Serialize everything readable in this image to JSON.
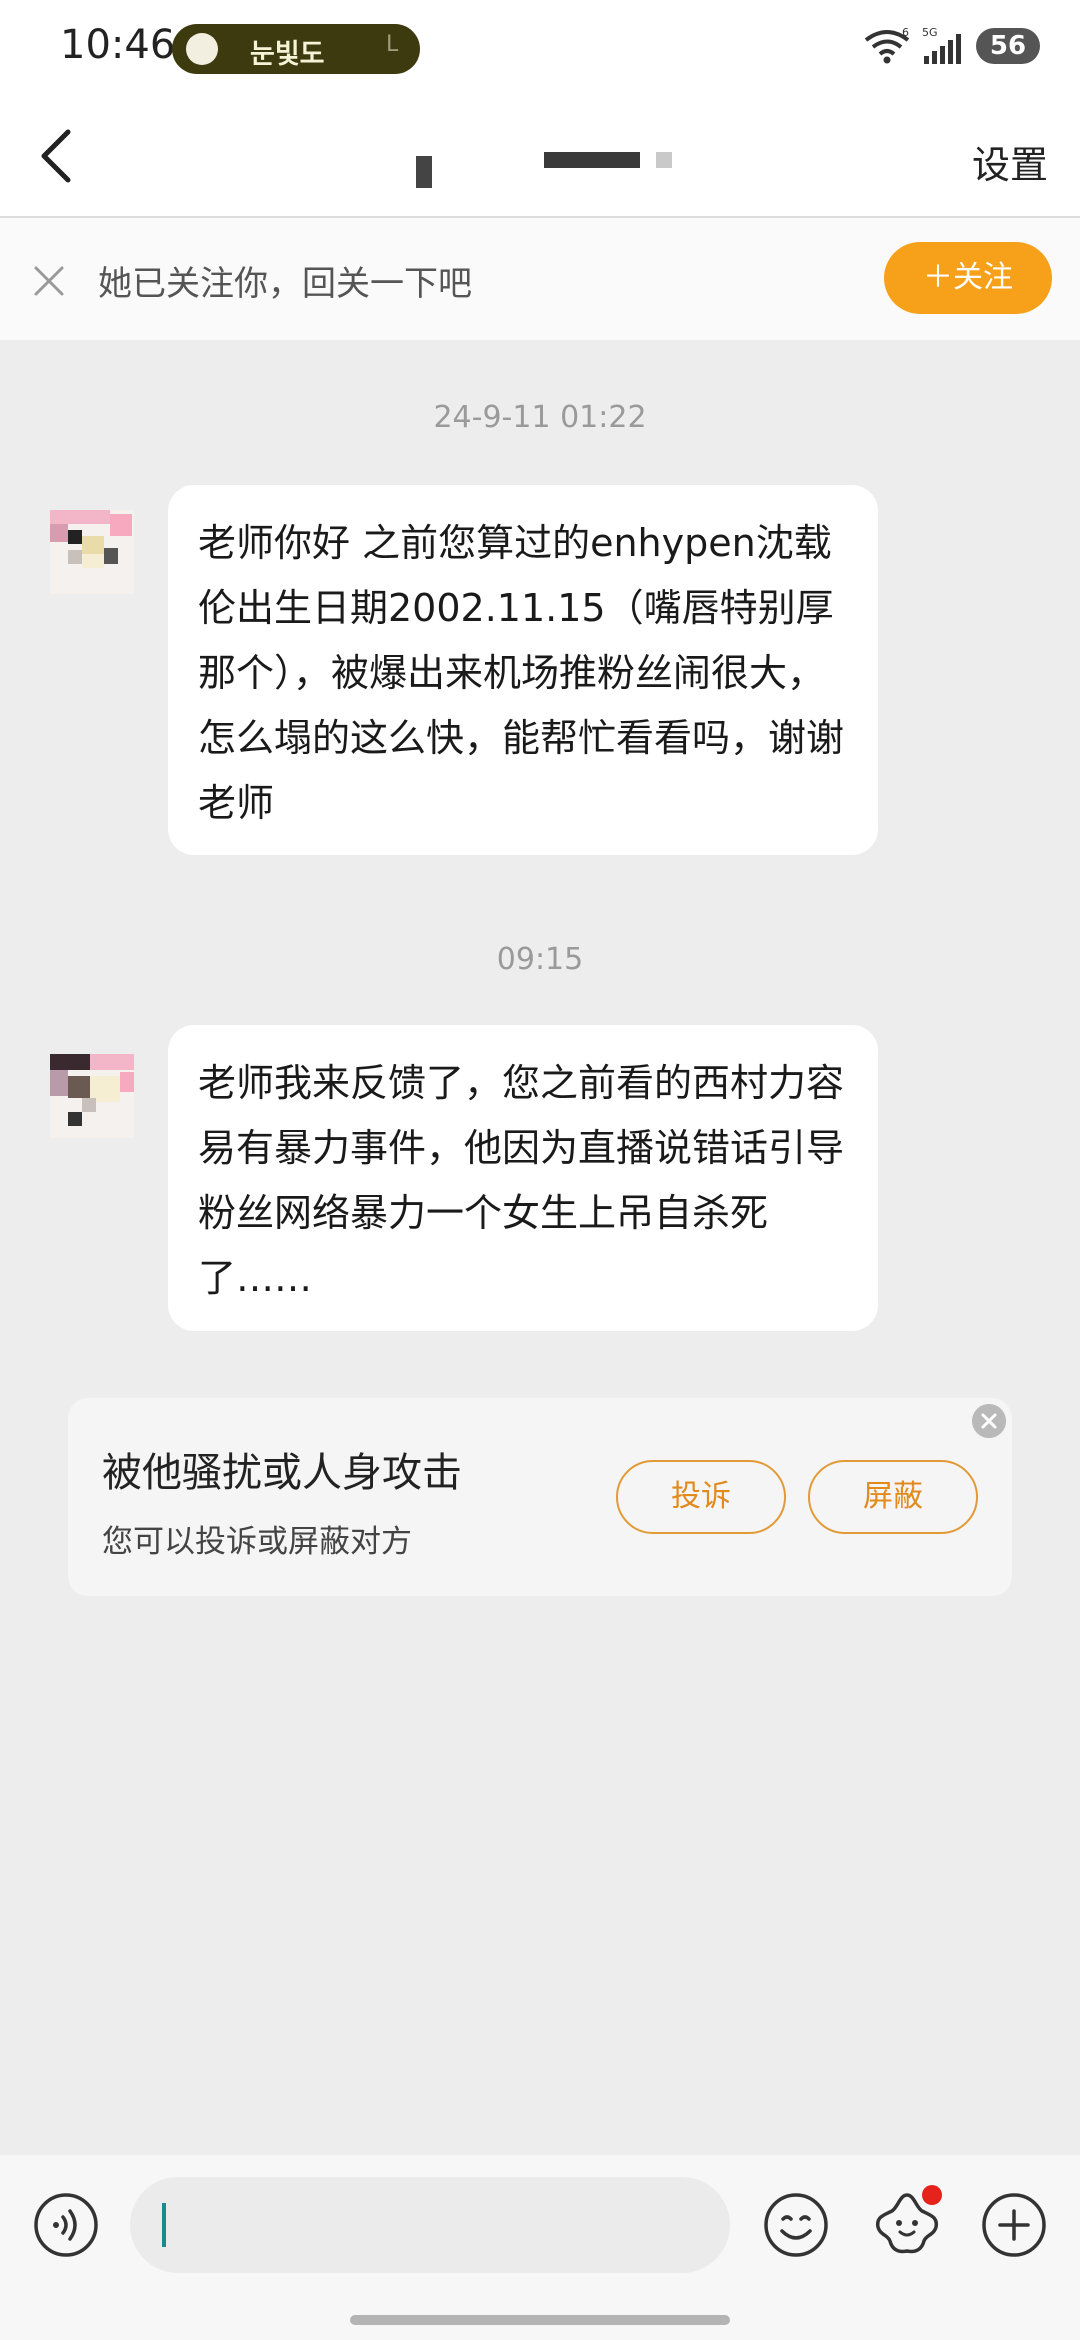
{
  "status_bar": {
    "time": "10:46",
    "pill_text": "눈빛도",
    "pill_tail": "L",
    "battery": "56",
    "signal_label": "5G",
    "wifi_label": "6"
  },
  "header": {
    "settings_label": "设置"
  },
  "banner": {
    "text": "她已关注你，回关一下吧",
    "follow_label": "＋关注"
  },
  "messages": [
    {
      "timestamp": "24-9-11 01:22",
      "text": "老师你好 之前您算过的enhypen沈载伦出生日期2002.11.15（嘴唇特别厚那个），被爆出来机场推粉丝闹很大，怎么塌的这么快，能帮忙看看吗，谢谢老师"
    },
    {
      "timestamp": "09:15",
      "text": "老师我来反馈了，您之前看的西村力容易有暴力事件，他因为直播说错话引导粉丝网络暴力一个女生上吊自杀死了……"
    }
  ],
  "harassment_card": {
    "title": "被他骚扰或人身攻击",
    "subtitle": "您可以投诉或屏蔽对方",
    "report_label": "投诉",
    "block_label": "屏蔽"
  },
  "colors": {
    "accent": "#f7a11a",
    "background": "#ededed",
    "notification_dot": "#e5231b"
  }
}
